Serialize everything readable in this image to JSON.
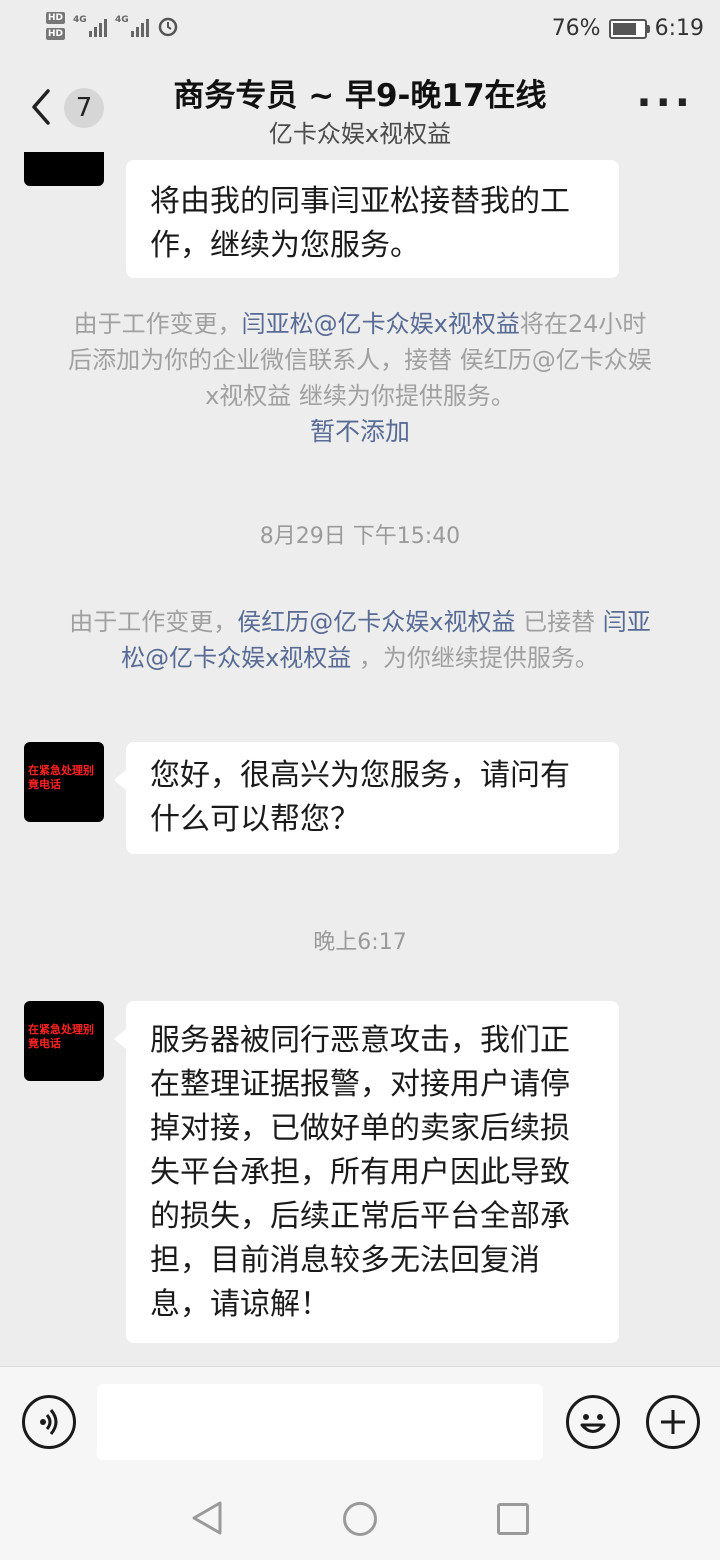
{
  "status_bar": {
    "hd1": "HD",
    "hd2": "HD",
    "net1": "4G",
    "net2": "4G",
    "battery_percent": "76%",
    "time": "6:19"
  },
  "header": {
    "back_count": "7",
    "title": "商务专员 ~ 早9-晚17在线",
    "subtitle": "亿卡众娱x视权益",
    "more": "···"
  },
  "avatar_text": "在紧急处理别竟电话",
  "messages": {
    "first_bubble": "将由我的同事闫亚松接替我的工作，继续为您服务。",
    "sys1": {
      "pre": "由于工作变更，",
      "link": "闫亚松@亿卡众娱x视权益",
      "post": "将在24小时后添加为你的企业微信联系人，接替 侯红历@亿卡众娱x视权益 继续为你提供服务。",
      "action": "暂不添加"
    },
    "time1": "8月29日 下午15:40",
    "sys2": {
      "pre": "由于工作变更，",
      "link1": "侯红历@亿卡众娱x视权益",
      "mid": " 已接替 ",
      "link2": "闫亚松@亿卡众娱x视权益",
      "post": " ，为你继续提供服务。"
    },
    "greeting": "您好，很高兴为您服务，请问有什么可以帮您？",
    "time2": "晚上6:17",
    "notice": "服务器被同行恶意攻击，我们正在整理证据报警，对接用户请停掉对接，已做好单的卖家后续损失平台承担，所有用户因此导致的损失，后续正常后平台全部承担，目前消息较多无法回复消息，请谅解！"
  }
}
